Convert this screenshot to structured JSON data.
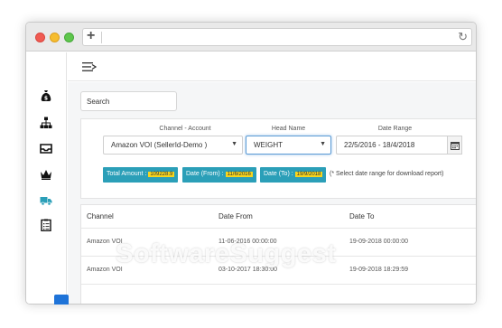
{
  "browser": {
    "new_tab_glyph": "+",
    "reload_glyph": "↻"
  },
  "sidebar": {
    "icons": [
      "money-bag-icon",
      "hierarchy-icon",
      "inbox-tray-icon",
      "crown-icon",
      "shipping-truck-icon",
      "clipboard-list-icon"
    ],
    "active": "shipping-truck-icon"
  },
  "search": {
    "placeholder": "Search"
  },
  "filters": {
    "channel_label": "Channel - Account",
    "channel_value": "Amazon VOI (SellerId-Demo )",
    "head_label": "Head Name",
    "head_value": "WEIGHT",
    "date_label": "Date Range",
    "date_value": "22/5/2016 - 18/4/2018"
  },
  "summary": {
    "total_label": "Total Amount :",
    "total_value": "109228.9",
    "from_label": "Date (From) :",
    "from_value": "11/6/2016",
    "to_label": "Date (To) :",
    "to_value": "19/9/2018",
    "note": "(* Select date range for download report)"
  },
  "table": {
    "headers": [
      "Channel",
      "Date From",
      "Date To"
    ],
    "rows": [
      [
        "Amazon VOI",
        "11-06-2016 00:00:00",
        "19-09-2018 00:00:00"
      ],
      [
        "Amazon VOI",
        "03-10-2017 18:30:00",
        "19-09-2018 18:29:59"
      ]
    ]
  },
  "watermark": "SoftwareSuggest",
  "colors": {
    "accent": "#2b9fb8",
    "badge": "#f7d51d",
    "active_icon": "#2b9fb8",
    "button_blue": "#1e73d8"
  }
}
